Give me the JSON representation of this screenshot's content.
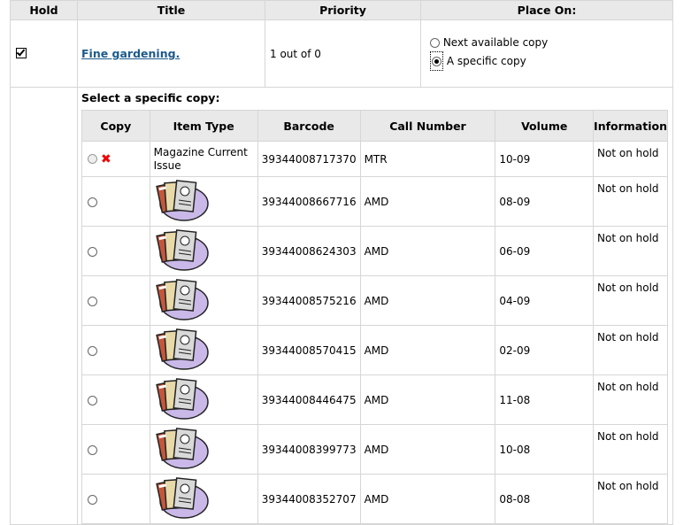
{
  "headers": {
    "hold": "Hold",
    "title": "Title",
    "priority": "Priority",
    "place_on": "Place On:"
  },
  "item": {
    "title": "Fine gardening.",
    "priority": "1 out of 0",
    "place_on_options": [
      "Next available copy",
      "A specific copy"
    ],
    "selected_option": "A specific copy",
    "hold_checked": true
  },
  "select_copy_heading": "Select a specific copy:",
  "copy_table": {
    "headers": {
      "copy": "Copy",
      "item_type": "Item Type",
      "barcode": "Barcode",
      "call_number": "Call Number",
      "volume": "Volume",
      "information": "Information"
    },
    "rows": [
      {
        "item_type": "Magazine Current Issue",
        "barcode": "39344008717370",
        "call_number": "MTR",
        "volume": "10-09",
        "information": "Not on hold",
        "disabled": true
      },
      {
        "item_type_icon": "magazine-icon",
        "barcode": "39344008667716",
        "call_number": "AMD",
        "volume": "08-09",
        "information": "Not on hold"
      },
      {
        "item_type_icon": "magazine-icon",
        "barcode": "39344008624303",
        "call_number": "AMD",
        "volume": "06-09",
        "information": "Not on hold"
      },
      {
        "item_type_icon": "magazine-icon",
        "barcode": "39344008575216",
        "call_number": "AMD",
        "volume": "04-09",
        "information": "Not on hold"
      },
      {
        "item_type_icon": "magazine-icon",
        "barcode": "39344008570415",
        "call_number": "AMD",
        "volume": "02-09",
        "information": "Not on hold"
      },
      {
        "item_type_icon": "magazine-icon",
        "barcode": "39344008446475",
        "call_number": "AMD",
        "volume": "11-08",
        "information": "Not on hold"
      },
      {
        "item_type_icon": "magazine-icon",
        "barcode": "39344008399773",
        "call_number": "AMD",
        "volume": "10-08",
        "information": "Not on hold"
      },
      {
        "item_type_icon": "magazine-icon",
        "barcode": "39344008352707",
        "call_number": "AMD",
        "volume": "08-08",
        "information": "Not on hold"
      }
    ]
  },
  "colors": {
    "header_bg": "#e9e9e9",
    "link": "#1d5a8c",
    "border": "#d6d6d6",
    "unavailable_x": "#e00000"
  }
}
